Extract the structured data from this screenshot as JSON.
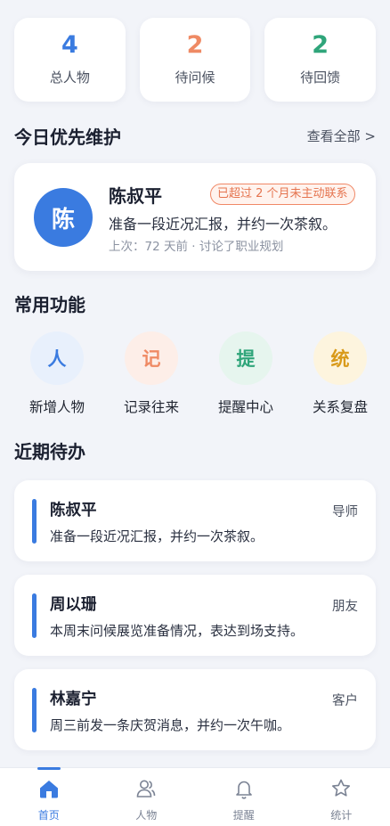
{
  "stats": [
    {
      "value": "4",
      "label": "总人物",
      "color": "#3a7be0"
    },
    {
      "value": "2",
      "label": "待问候",
      "color": "#ef8a64"
    },
    {
      "value": "2",
      "label": "待回馈",
      "color": "#2fa57a"
    }
  ],
  "priority_section": {
    "title": "今日优先维护",
    "view_all": "查看全部 >"
  },
  "priority": {
    "avatar": "陈",
    "name": "陈叔平",
    "badge": "已超过 2 个月未主动联系",
    "desc": "准备一段近况汇报，并约一次茶叙。",
    "meta": "上次：72 天前 · 讨论了职业规划"
  },
  "functions_section": {
    "title": "常用功能"
  },
  "functions": [
    {
      "glyph": "人",
      "label": "新增人物",
      "bg": "#e8f0fc",
      "fg": "#3a7be0"
    },
    {
      "glyph": "记",
      "label": "记录往来",
      "bg": "#fdeee8",
      "fg": "#ef8a64"
    },
    {
      "glyph": "提",
      "label": "提醒中心",
      "bg": "#e6f5ee",
      "fg": "#2fa57a"
    },
    {
      "glyph": "统",
      "label": "关系复盘",
      "bg": "#fdf4de",
      "fg": "#d99a1a"
    }
  ],
  "todo_section": {
    "title": "近期待办"
  },
  "todos": [
    {
      "name": "陈叔平",
      "tag": "导师",
      "desc": "准备一段近况汇报，并约一次茶叙。"
    },
    {
      "name": "周以珊",
      "tag": "朋友",
      "desc": "本周末问候展览准备情况，表达到场支持。"
    },
    {
      "name": "林嘉宁",
      "tag": "客户",
      "desc": "周三前发一条庆贺消息，并约一次午咖。"
    }
  ],
  "nav": [
    {
      "label": "首页",
      "icon": "home-icon",
      "active": true
    },
    {
      "label": "人物",
      "icon": "people-icon"
    },
    {
      "label": "提醒",
      "icon": "bell-icon"
    },
    {
      "label": "统计",
      "icon": "star-icon"
    }
  ]
}
